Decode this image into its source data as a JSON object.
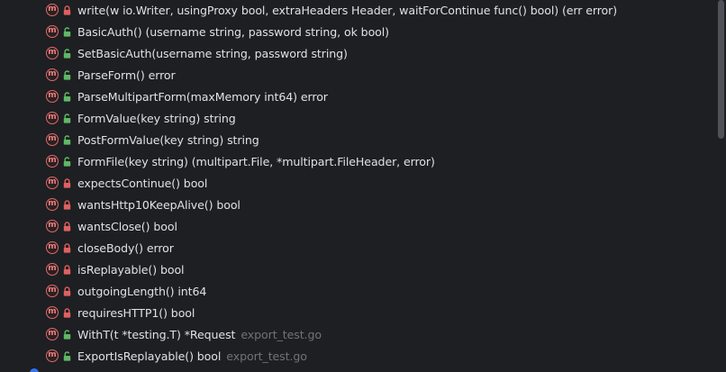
{
  "colors": {
    "background": "#1e1f22",
    "text": "#dfe1e5",
    "muted": "#6f737a",
    "method_icon": "#e06a6a",
    "lock_private": "#e06060",
    "lock_public": "#5fb865"
  },
  "method_icon_letter": "m",
  "rows": [
    {
      "label": "write(w io.Writer, usingProxy bool, extraHeaders Header, waitForContinue func() bool) (err error)",
      "access": "private",
      "file": ""
    },
    {
      "label": "BasicAuth() (username string, password string, ok bool)",
      "access": "public",
      "file": ""
    },
    {
      "label": "SetBasicAuth(username string, password string)",
      "access": "public",
      "file": ""
    },
    {
      "label": "ParseForm() error",
      "access": "public",
      "file": ""
    },
    {
      "label": "ParseMultipartForm(maxMemory int64) error",
      "access": "public",
      "file": ""
    },
    {
      "label": "FormValue(key string) string",
      "access": "public",
      "file": ""
    },
    {
      "label": "PostFormValue(key string) string",
      "access": "public",
      "file": ""
    },
    {
      "label": "FormFile(key string) (multipart.File, *multipart.FileHeader, error)",
      "access": "public",
      "file": ""
    },
    {
      "label": "expectsContinue() bool",
      "access": "private",
      "file": ""
    },
    {
      "label": "wantsHttp10KeepAlive() bool",
      "access": "private",
      "file": ""
    },
    {
      "label": "wantsClose() bool",
      "access": "private",
      "file": ""
    },
    {
      "label": "closeBody() error",
      "access": "private",
      "file": ""
    },
    {
      "label": "isReplayable() bool",
      "access": "private",
      "file": ""
    },
    {
      "label": "outgoingLength() int64",
      "access": "private",
      "file": ""
    },
    {
      "label": "requiresHTTP1() bool",
      "access": "private",
      "file": ""
    },
    {
      "label": "WithT(t *testing.T) *Request",
      "access": "public",
      "file": "export_test.go"
    },
    {
      "label": "ExportIsReplayable() bool",
      "access": "public",
      "file": "export_test.go"
    }
  ]
}
